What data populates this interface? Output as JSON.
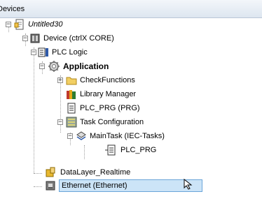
{
  "panel": {
    "title": "Devices"
  },
  "tree": [
    {
      "label": "Untitled30",
      "italic": true,
      "icon": "project-icon",
      "expander": "−"
    },
    {
      "label": "Device (ctrlX CORE)",
      "icon": "device-icon",
      "expander": "−"
    },
    {
      "label": "PLC Logic",
      "icon": "plc-logic-icon",
      "expander": "−"
    },
    {
      "label": "Application",
      "bold": true,
      "icon": "application-gear-icon",
      "expander": "−"
    },
    {
      "label": "CheckFunctions",
      "icon": "folder-icon",
      "expander": "+"
    },
    {
      "label": "Library Manager",
      "icon": "library-books-icon"
    },
    {
      "label": "PLC_PRG (PRG)",
      "icon": "program-document-icon"
    },
    {
      "label": "Task Configuration",
      "icon": "task-configuration-icon",
      "expander": "−"
    },
    {
      "label": "MainTask (IEC-Tasks)",
      "icon": "task-icon",
      "expander": "−"
    },
    {
      "label": "PLC_PRG",
      "icon": "program-call-icon"
    },
    {
      "label": "DataLayer_Realtime",
      "icon": "datalayer-icon"
    },
    {
      "label": "Ethernet (Ethernet)",
      "icon": "ethernet-icon",
      "selected": true
    }
  ]
}
